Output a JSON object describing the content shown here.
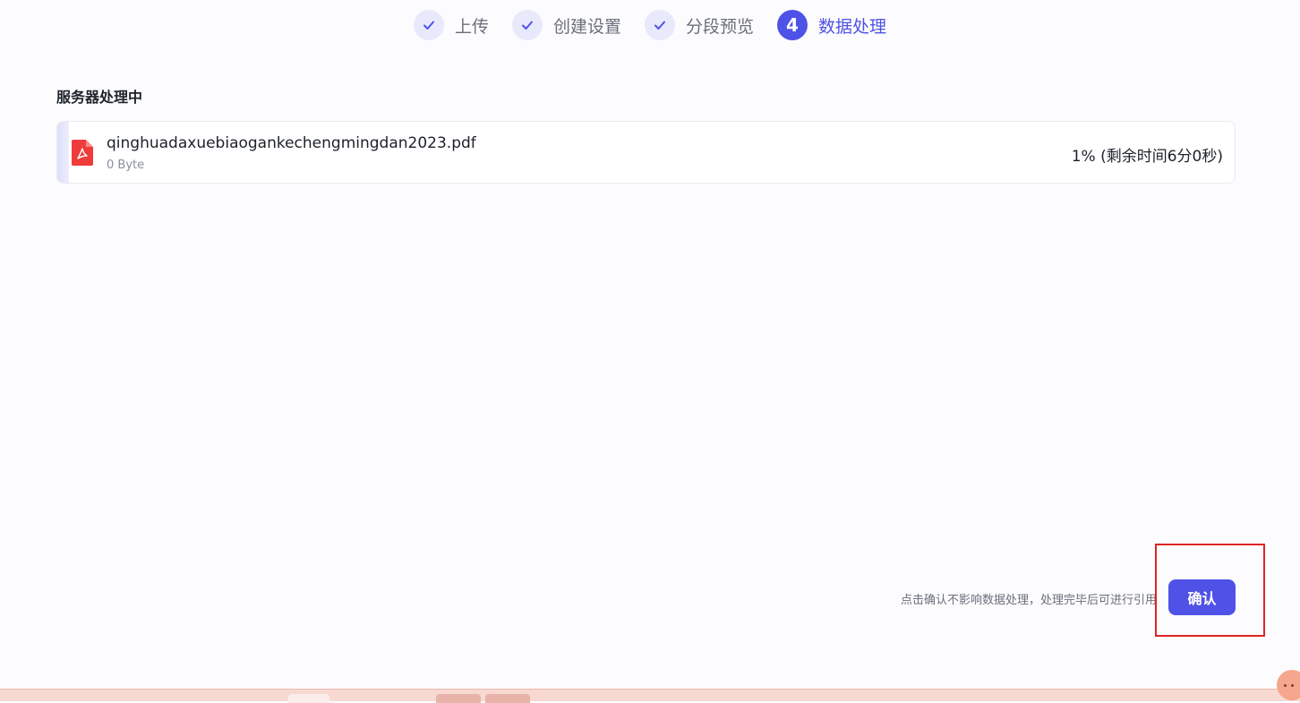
{
  "steps": [
    {
      "label": "上传",
      "status": "done"
    },
    {
      "label": "创建设置",
      "status": "done"
    },
    {
      "label": "分段预览",
      "status": "done"
    },
    {
      "number": "4",
      "label": "数据处理",
      "status": "active"
    }
  ],
  "section": {
    "title": "服务器处理中"
  },
  "file": {
    "name": "qinghuadaxuebiaogankechengmingdan2023.pdf",
    "size": "0 Byte",
    "status": "1% (剩余时间6分0秒)",
    "progress_percent": 1,
    "icon": "pdf-file-icon"
  },
  "footer": {
    "hint": "点击确认不影响数据处理，处理完毕后可进行引用",
    "confirm_label": "确认"
  },
  "colors": {
    "accent": "#4f52e6",
    "step_done_bg": "#e8e9fb",
    "pdf_red": "#f03b3b",
    "highlight": "#e02424"
  }
}
